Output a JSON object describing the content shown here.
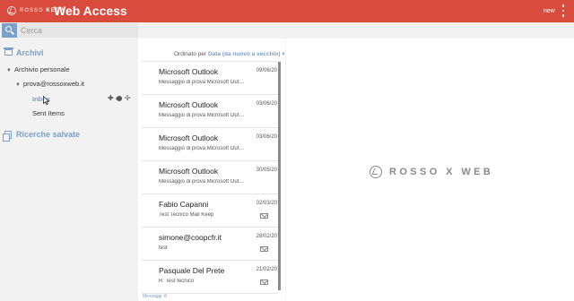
{
  "colors": {
    "header": "#d94b3d",
    "accent": "#7a9fc9",
    "sidebar": "#f2f2f2"
  },
  "header": {
    "logo_prefix": "ROSSO",
    "logo_suffix": "KEEP",
    "title": "Web Access",
    "user": "new"
  },
  "search": {
    "placeholder": "Cerca"
  },
  "sidebar": {
    "archives_title": "Archivi",
    "personal_archive": "Archivio personale",
    "account": "prova@rossoxweb.it",
    "folders": [
      "Inbox",
      "Sent Items"
    ],
    "saved_searches_title": "Ricerche salvate"
  },
  "list": {
    "sort_prefix": "Ordinato per",
    "sort_value": "Data (da nuovo a vecchio)",
    "messages": [
      {
        "from": "Microsoft Outlook",
        "date": "09/06/20",
        "preview": "Messaggio di prova Microsoft Outlook"
      },
      {
        "from": "Microsoft Outlook",
        "date": "03/06/20",
        "preview": "Messaggio di prova Microsoft Outlook"
      },
      {
        "from": "Microsoft Outlook",
        "date": "03/06/20",
        "preview": "Messaggio di prova Microsoft Outlook"
      },
      {
        "from": "Microsoft Outlook",
        "date": "30/05/20",
        "preview": "Messaggio di prova Microsoft Outlook"
      },
      {
        "from": "Fabio Capanni",
        "date": "02/03/20",
        "preview": "Test Tecnico Mail Keep"
      },
      {
        "from": "simone@coopcfr.it",
        "date": "28/02/20",
        "preview": "test"
      },
      {
        "from": "Pasquale Del Prete",
        "date": "21/02/20",
        "preview": "R: Test tecnico"
      }
    ],
    "count": "Messaggi: 8"
  },
  "viewer": {
    "brand": "ROSSO X WEB"
  }
}
